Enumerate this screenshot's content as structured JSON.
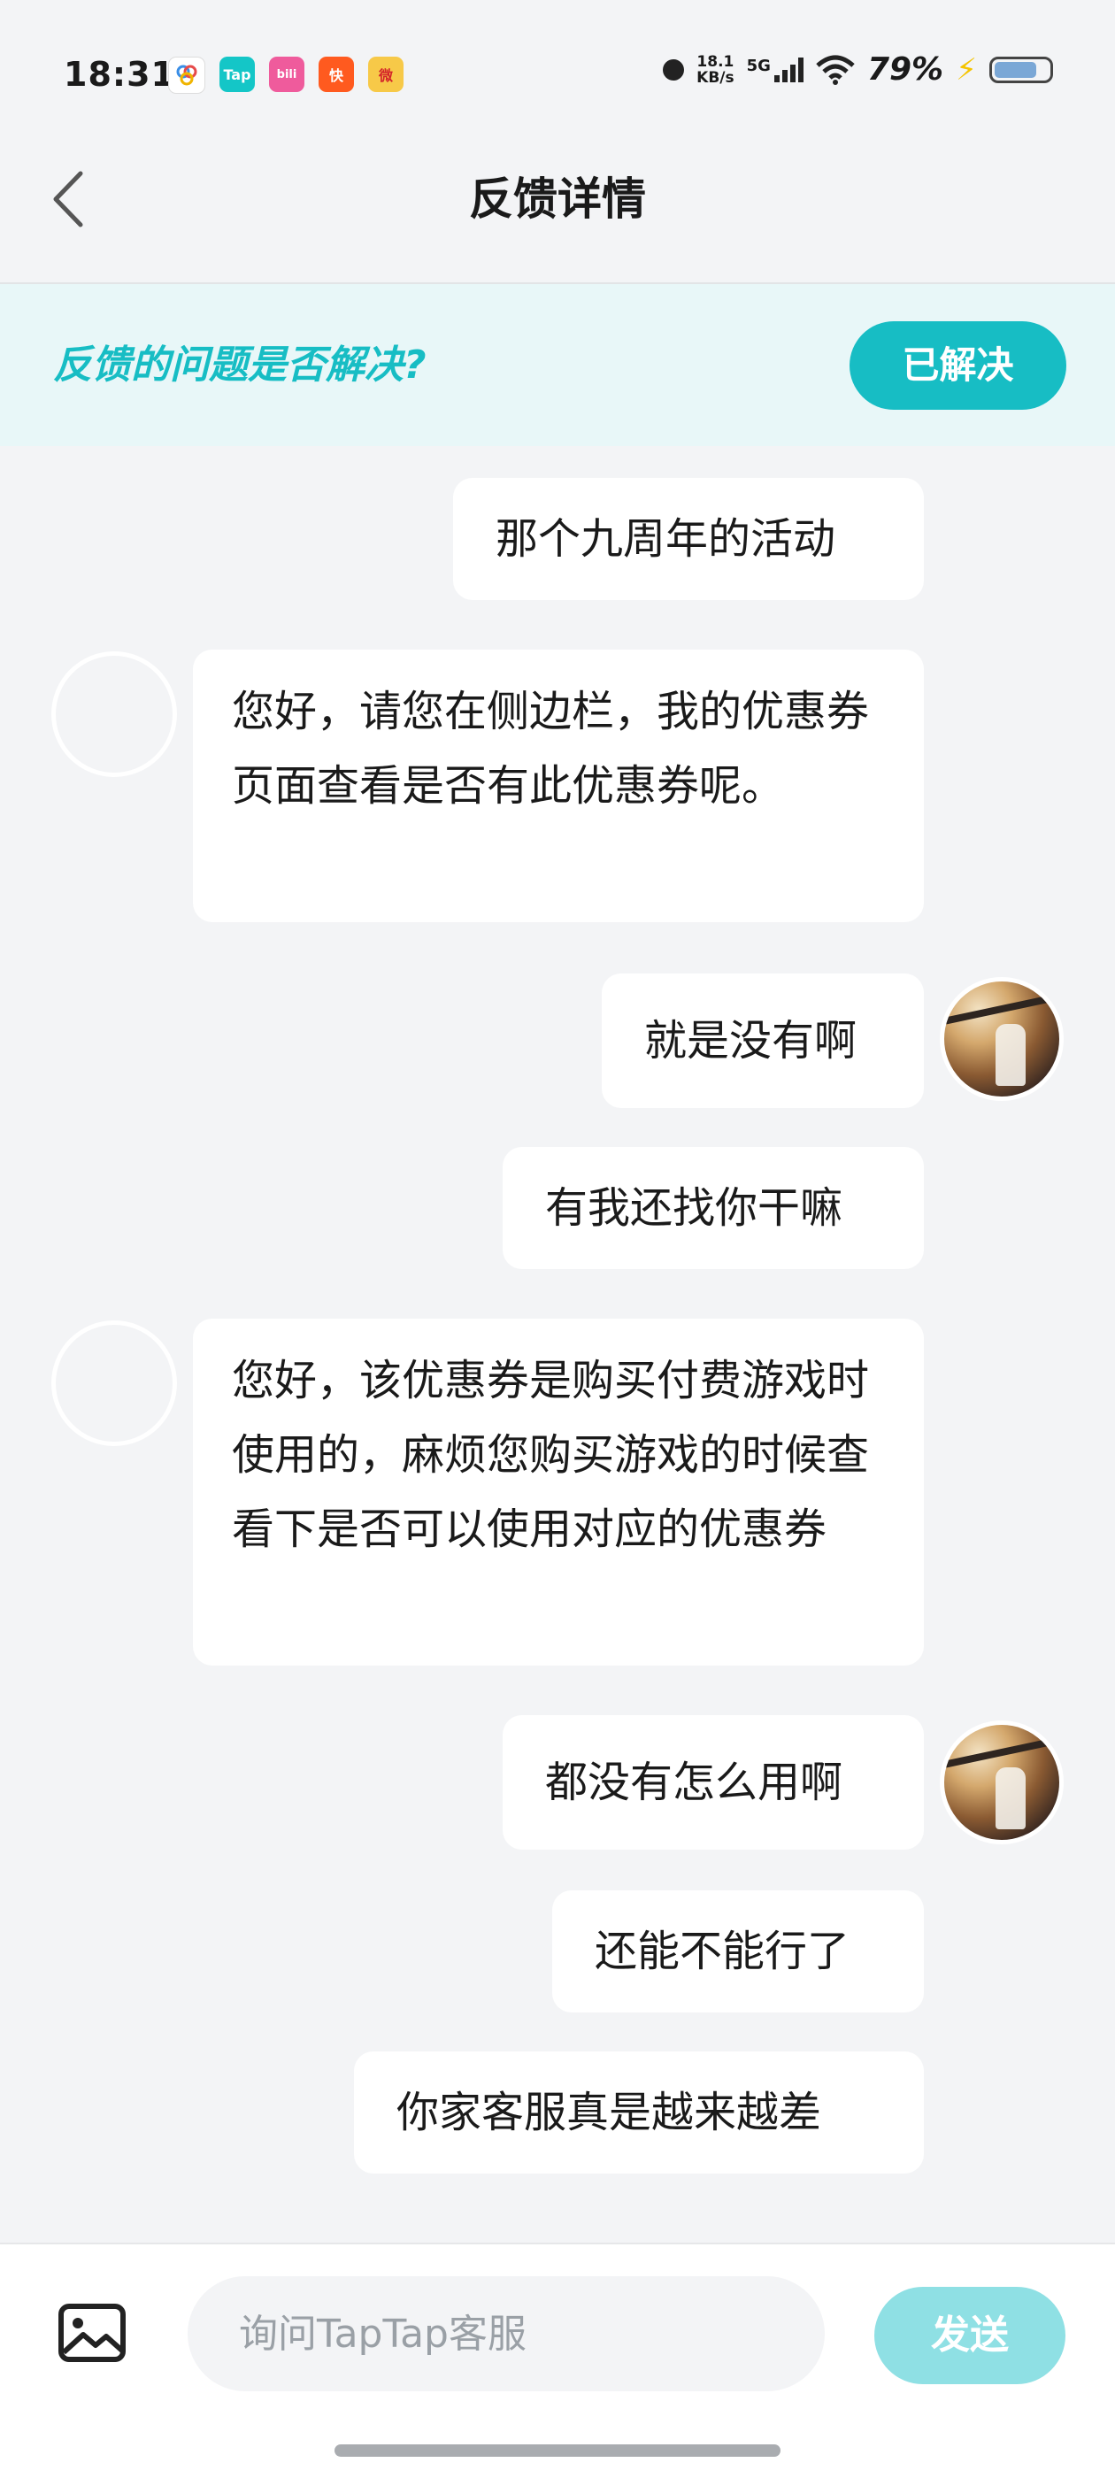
{
  "status_bar": {
    "time": "18:31",
    "apps": [
      {
        "icon": "multi-circle-app-icon",
        "label": "",
        "color": "#ffffff"
      },
      {
        "icon": "taptap-app-icon",
        "label": "Tap",
        "color": "#14c6c7"
      },
      {
        "icon": "bilibili-app-icon",
        "label": "bili",
        "color": "#ef5b9c"
      },
      {
        "icon": "kuaishou-app-icon",
        "label": "快",
        "color": "#ff5a1f"
      },
      {
        "icon": "weibo-app-icon",
        "label": "微",
        "color": "#f7c948"
      }
    ],
    "net_speed_value": "18.1",
    "net_speed_unit": "KB/s",
    "network": "5G",
    "battery": "79%",
    "battery_level": 0.79
  },
  "header": {
    "title": "反馈详情"
  },
  "banner": {
    "question": "反馈的问题是否解决?",
    "resolved_label": "已解决"
  },
  "messages": [
    {
      "from": "user",
      "text": "那个九周年的活动",
      "avatar": false
    },
    {
      "from": "agent",
      "text": "您好，请您在侧边栏，我的优惠券页面查看是否有此优惠券呢。",
      "avatar": true
    },
    {
      "from": "user",
      "text": "就是没有啊",
      "avatar": true
    },
    {
      "from": "user",
      "text": "有我还找你干嘛",
      "avatar": false
    },
    {
      "from": "agent",
      "text": "您好，该优惠券是购买付费游戏时使用的，麻烦您购买游戏的时候查看下是否可以使用对应的优惠券",
      "avatar": true
    },
    {
      "from": "user",
      "text": "都没有怎么用啊",
      "avatar": true
    },
    {
      "from": "user",
      "text": "还能不能行了",
      "avatar": false
    },
    {
      "from": "user",
      "text": "你家客服真是越来越差",
      "avatar": false
    }
  ],
  "input_bar": {
    "placeholder": "询问TapTap客服",
    "send_label": "发送"
  },
  "colors": {
    "accent": "#17bdc4",
    "banner_bg": "#e8f7f8",
    "send_disabled": "#8fe0e4",
    "page_bg": "#f3f4f6"
  }
}
